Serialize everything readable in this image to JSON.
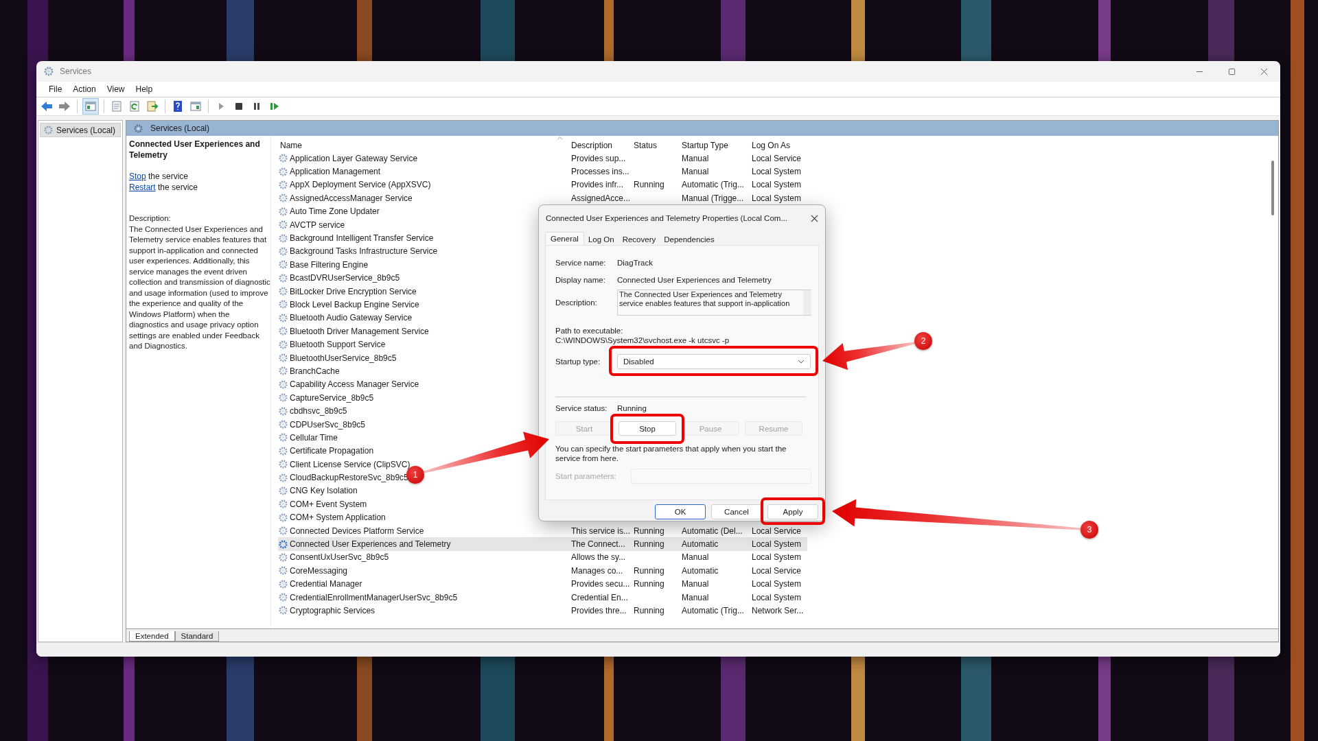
{
  "window": {
    "title": "Services"
  },
  "menu": [
    "File",
    "Action",
    "View",
    "Help"
  ],
  "tree": [
    {
      "label": "Services (Local)",
      "selected": true
    }
  ],
  "pane_header": "Services (Local)",
  "detail": {
    "title": "Connected User Experiences and Telemetry",
    "actions": [
      {
        "link": "Stop",
        "text": "the service"
      },
      {
        "link": "Restart",
        "text": "the service"
      }
    ],
    "description_label": "Description:",
    "description": "The Connected User Experiences and Telemetry service enables features that support in-application and connected user experiences. Additionally, this service manages the event driven collection and transmission of diagnostic and usage information (used to improve the experience and quality of the Windows Platform) when the diagnostics and usage privacy option settings are enabled under Feedback and Diagnostics."
  },
  "table": {
    "columns": [
      "Name",
      "Description",
      "Status",
      "Startup Type",
      "Log On As"
    ],
    "rows": [
      {
        "name": "Application Layer Gateway Service",
        "description": "Provides sup...",
        "status": "",
        "startup_type": "Manual",
        "log_on_as": "Local Service",
        "selected": false
      },
      {
        "name": "Application Management",
        "description": "Processes ins...",
        "status": "",
        "startup_type": "Manual",
        "log_on_as": "Local System",
        "selected": false
      },
      {
        "name": "AppX Deployment Service (AppXSVC)",
        "description": "Provides infr...",
        "status": "Running",
        "startup_type": "Automatic (Trig...",
        "log_on_as": "Local System",
        "selected": false
      },
      {
        "name": "AssignedAccessManager Service",
        "description": "AssignedAcce...",
        "status": "",
        "startup_type": "Manual (Trigge...",
        "log_on_as": "Local System",
        "selected": false
      },
      {
        "name": "Auto Time Zone Updater",
        "selected": false
      },
      {
        "name": "AVCTP service",
        "selected": false
      },
      {
        "name": "Background Intelligent Transfer Service",
        "selected": false
      },
      {
        "name": "Background Tasks Infrastructure Service",
        "selected": false
      },
      {
        "name": "Base Filtering Engine",
        "selected": false
      },
      {
        "name": "BcastDVRUserService_8b9c5",
        "selected": false
      },
      {
        "name": "BitLocker Drive Encryption Service",
        "selected": false
      },
      {
        "name": "Block Level Backup Engine Service",
        "selected": false
      },
      {
        "name": "Bluetooth Audio Gateway Service",
        "selected": false
      },
      {
        "name": "Bluetooth Driver Management Service",
        "selected": false
      },
      {
        "name": "Bluetooth Support Service",
        "selected": false
      },
      {
        "name": "BluetoothUserService_8b9c5",
        "selected": false
      },
      {
        "name": "BranchCache",
        "selected": false
      },
      {
        "name": "Capability Access Manager Service",
        "selected": false
      },
      {
        "name": "CaptureService_8b9c5",
        "selected": false
      },
      {
        "name": "cbdhsvc_8b9c5",
        "selected": false
      },
      {
        "name": "CDPUserSvc_8b9c5",
        "selected": false
      },
      {
        "name": "Cellular Time",
        "selected": false
      },
      {
        "name": "Certificate Propagation",
        "selected": false
      },
      {
        "name": "Client License Service (ClipSVC)",
        "selected": false
      },
      {
        "name": "CloudBackupRestoreSvc_8b9c5",
        "selected": false
      },
      {
        "name": "CNG Key Isolation",
        "selected": false
      },
      {
        "name": "COM+ Event System",
        "selected": false
      },
      {
        "name": "COM+ System Application",
        "selected": false
      },
      {
        "name": "Connected Devices Platform Service",
        "description": "This service is...",
        "status": "Running",
        "startup_type": "Automatic (Del...",
        "log_on_as": "Local Service",
        "selected": false
      },
      {
        "name": "Connected User Experiences and Telemetry",
        "description": "The Connect...",
        "status": "Running",
        "startup_type": "Automatic",
        "log_on_as": "Local System",
        "selected": true
      },
      {
        "name": "ConsentUxUserSvc_8b9c5",
        "description": "Allows the sy...",
        "status": "",
        "startup_type": "Manual",
        "log_on_as": "Local System",
        "selected": false
      },
      {
        "name": "CoreMessaging",
        "description": "Manages co...",
        "status": "Running",
        "startup_type": "Automatic",
        "log_on_as": "Local Service",
        "selected": false
      },
      {
        "name": "Credential Manager",
        "description": "Provides secu...",
        "status": "Running",
        "startup_type": "Manual",
        "log_on_as": "Local System",
        "selected": false
      },
      {
        "name": "CredentialEnrollmentManagerUserSvc_8b9c5",
        "description": "Credential En...",
        "status": "",
        "startup_type": "Manual",
        "log_on_as": "Local System",
        "selected": false
      },
      {
        "name": "Cryptographic Services",
        "description": "Provides thre...",
        "status": "Running",
        "startup_type": "Automatic (Trig...",
        "log_on_as": "Network Ser...",
        "selected": false
      }
    ]
  },
  "view_tabs": [
    {
      "label": "Extended",
      "selected": true
    },
    {
      "label": "Standard",
      "selected": false
    }
  ],
  "dialog": {
    "title": "Connected User Experiences and Telemetry Properties (Local Com...",
    "tabs": [
      {
        "label": "General",
        "selected": true
      },
      {
        "label": "Log On",
        "selected": false
      },
      {
        "label": "Recovery",
        "selected": false
      },
      {
        "label": "Dependencies",
        "selected": false
      }
    ],
    "service_name_label": "Service name:",
    "service_name": "DiagTrack",
    "display_name_label": "Display name:",
    "display_name": "Connected User Experiences and Telemetry",
    "description_label": "Description:",
    "description_lines": [
      "The Connected User Experiences and Telemetry",
      "service enables features that support in-application"
    ],
    "path_label": "Path to executable:",
    "path": "C:\\WINDOWS\\System32\\svchost.exe -k utcsvc -p",
    "startup_type_label": "Startup type:",
    "startup_type": "Disabled",
    "service_status_label": "Service status:",
    "service_status": "Running",
    "service_buttons": [
      {
        "label": "Start",
        "disabled": true
      },
      {
        "label": "Stop",
        "disabled": false
      },
      {
        "label": "Pause",
        "disabled": true
      },
      {
        "label": "Resume",
        "disabled": true
      }
    ],
    "hint": "You can specify the start parameters that apply when you start the service from here.",
    "start_parameters": {
      "label": "Start parameters:",
      "disabled": true
    },
    "buttons": [
      {
        "label": "OK",
        "default": true
      },
      {
        "label": "Cancel",
        "default": false
      },
      {
        "label": "Apply",
        "default": false
      }
    ]
  },
  "annotations": [
    {
      "number": "1"
    },
    {
      "number": "2"
    },
    {
      "number": "3"
    }
  ]
}
